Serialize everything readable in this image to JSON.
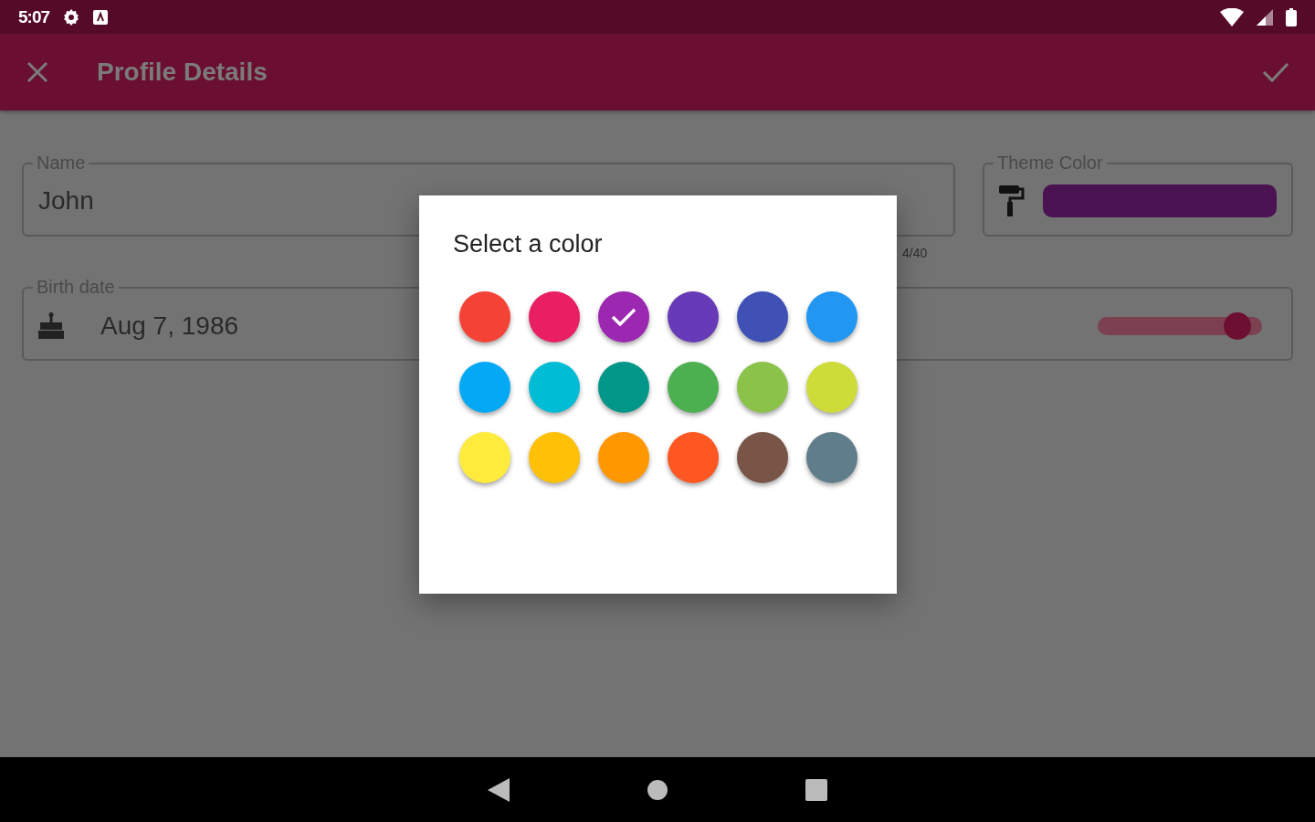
{
  "status_bar": {
    "time": "5:07"
  },
  "app_bar": {
    "title": "Profile Details"
  },
  "form": {
    "name_field": {
      "label": "Name",
      "value": "John",
      "counter": "4/40"
    },
    "theme_field": {
      "label": "Theme Color",
      "color": "#4a1251"
    },
    "birth_field": {
      "label": "Birth date",
      "value": "Aug 7, 1986"
    },
    "slider": {
      "level": 0.92
    }
  },
  "dialog": {
    "title": "Select a color",
    "swatches": [
      {
        "color": "#f44336",
        "selected": false
      },
      {
        "color": "#e91e63",
        "selected": false
      },
      {
        "color": "#9c27b0",
        "selected": true
      },
      {
        "color": "#673ab7",
        "selected": false
      },
      {
        "color": "#3f51b5",
        "selected": false
      },
      {
        "color": "#2196f3",
        "selected": false
      },
      {
        "color": "#03a9f4",
        "selected": false
      },
      {
        "color": "#00bcd4",
        "selected": false
      },
      {
        "color": "#009688",
        "selected": false
      },
      {
        "color": "#4caf50",
        "selected": false
      },
      {
        "color": "#8bc34a",
        "selected": false
      },
      {
        "color": "#cddc39",
        "selected": false
      },
      {
        "color": "#ffeb3b",
        "selected": false
      },
      {
        "color": "#ffc107",
        "selected": false
      },
      {
        "color": "#ff9800",
        "selected": false
      },
      {
        "color": "#ff5722",
        "selected": false
      },
      {
        "color": "#795548",
        "selected": false
      },
      {
        "color": "#607d8b",
        "selected": false
      }
    ]
  }
}
